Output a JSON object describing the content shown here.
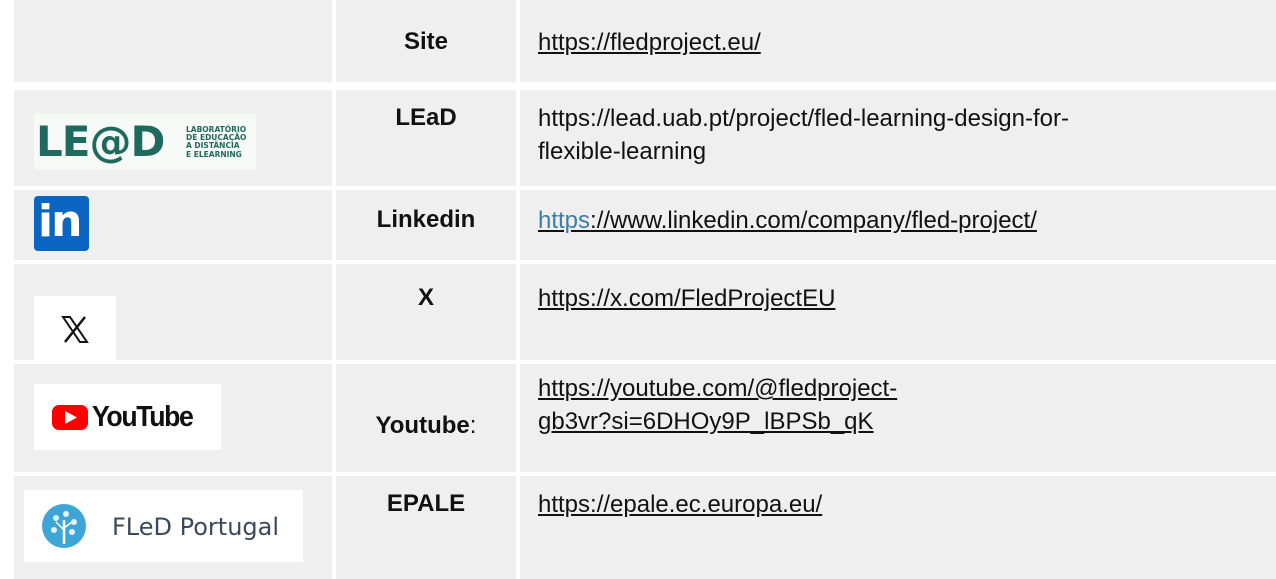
{
  "rows": [
    {
      "name": "Site",
      "url_lines": [
        "https://fledproject.eu/"
      ]
    },
    {
      "name": "LEaD",
      "logo": {
        "icon": "lead-logo",
        "text_big": "LE@D",
        "text_small": [
          "LABORATÓRIO",
          "DE EDUCAÇÃO",
          "A DISTÂNCIA",
          "E ELEARNING"
        ]
      },
      "url_lines": [
        "https://lead.uab.pt/project/fled-learning-design-for-",
        "flexible-learning"
      ]
    },
    {
      "name": "Linkedin",
      "logo": {
        "icon": "linkedin-icon",
        "text": "in"
      },
      "url_prefix": "https",
      "url_rest": "://www.linkedin.com/company/fled-project/"
    },
    {
      "name": "X",
      "logo": {
        "icon": "x-icon"
      },
      "url_lines": [
        "https://x.com/FledProjectEU"
      ]
    },
    {
      "name": "Youtube",
      "name_suffix": ":",
      "logo": {
        "icon": "youtube-icon",
        "text": "YouTube"
      },
      "url_lines": [
        "https://youtube.com/@fledproject-",
        "gb3vr?si=6DHOy9P_lBPSb_qK"
      ]
    },
    {
      "name": "EPALE",
      "logo": {
        "icon": "fled-portugal-logo",
        "text": "FLeD Portugal"
      },
      "url_lines": [
        "https://epale.ec.europa.eu/"
      ]
    }
  ],
  "colors": {
    "row_bg": "#efefef",
    "linkedin": "#0a66c2",
    "youtube_red": "#ff0000",
    "lead_green": "#1f6a5e",
    "link_teal": "#3d7ea6"
  }
}
